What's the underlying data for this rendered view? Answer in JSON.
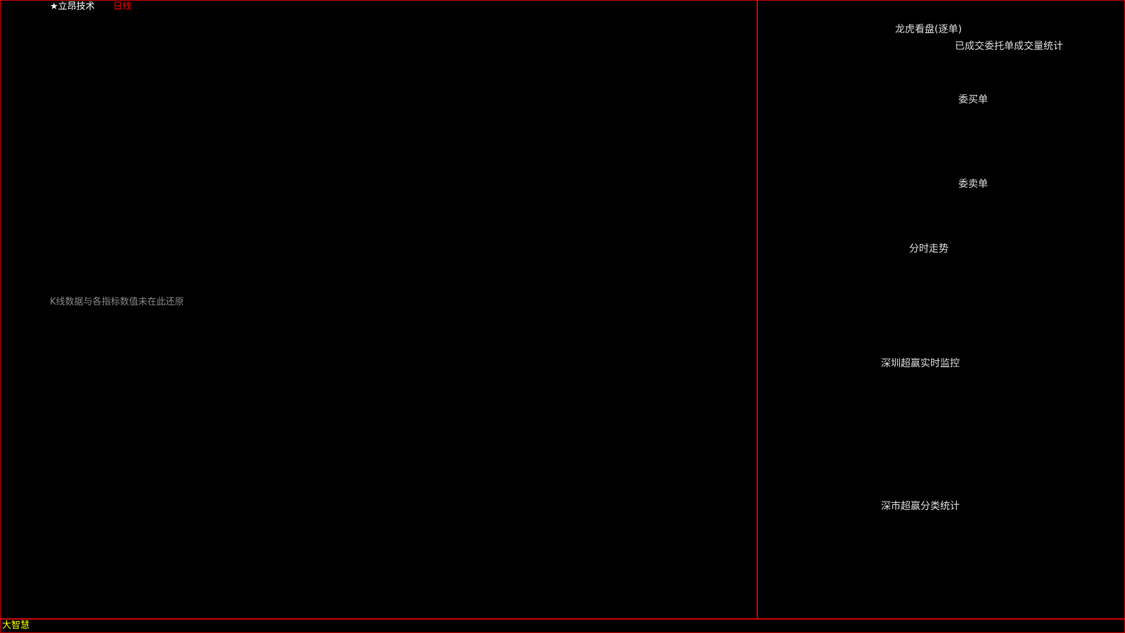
{
  "chart": {
    "name": "★立昂技术",
    "period": "日线",
    "notice": "K线数据与各指标数值未在此还原"
  },
  "right_panel": {
    "title": "龙虎看盘(逐单)",
    "subtitle": "已成交委托单成交量统计",
    "buy_side": "委买单",
    "sell_side": "委卖单",
    "intraday": "分时走势",
    "monitor": "深圳超赢实时监控",
    "classification": "深市超赢分类统计"
  },
  "status": {
    "brand": "大智慧"
  }
}
